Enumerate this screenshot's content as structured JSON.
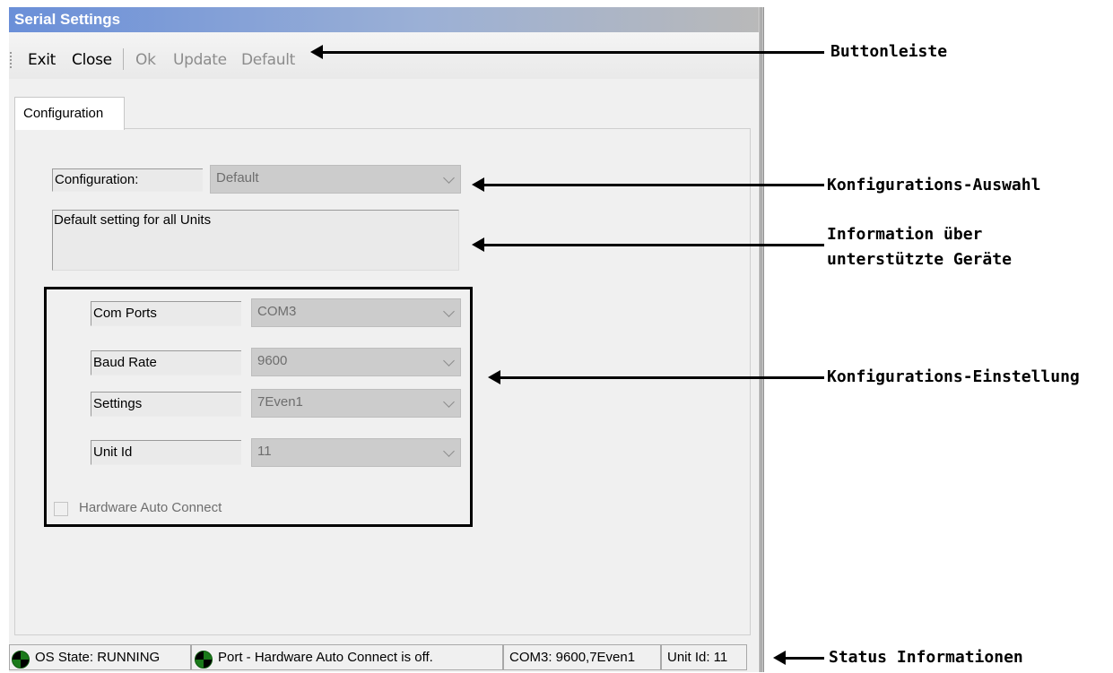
{
  "window": {
    "title": "Serial Settings"
  },
  "toolbar": {
    "exit": "Exit",
    "close": "Close",
    "ok": "Ok",
    "update": "Update",
    "default": "Default"
  },
  "tab": {
    "label": "Configuration"
  },
  "form": {
    "configuration_label": "Configuration:",
    "configuration_value": "Default",
    "info_text": "Default setting for all Units",
    "com_ports_label": "Com Ports",
    "com_ports_value": "COM3",
    "baud_rate_label": "Baud Rate",
    "baud_rate_value": "9600",
    "settings_label": "Settings",
    "settings_value": "7Even1",
    "unit_id_label": "Unit Id",
    "unit_id_value": "11",
    "hardware_auto_connect_label": "Hardware Auto Connect",
    "hardware_auto_connect_checked": false
  },
  "statusbar": {
    "os_state": "OS State: RUNNING",
    "port": "Port - Hardware Auto Connect is off.",
    "com": "COM3: 9600,7Even1",
    "unit": "Unit Id: 11",
    "icon": "status-led-icon"
  },
  "annotations": {
    "buttonleiste": "Buttonleiste",
    "konfig_auswahl": "Konfigurations-Auswahl",
    "info_line1": "Information über",
    "info_line2": "unterstützte Geräte",
    "konfig_einstellung": "Konfigurations-Einstellung",
    "status_info": "Status Informationen"
  },
  "colors": {
    "title_gradient_start": "#6a8fd8",
    "disabled_text": "#8c8c8c",
    "status_led": "#1a7a1a"
  }
}
